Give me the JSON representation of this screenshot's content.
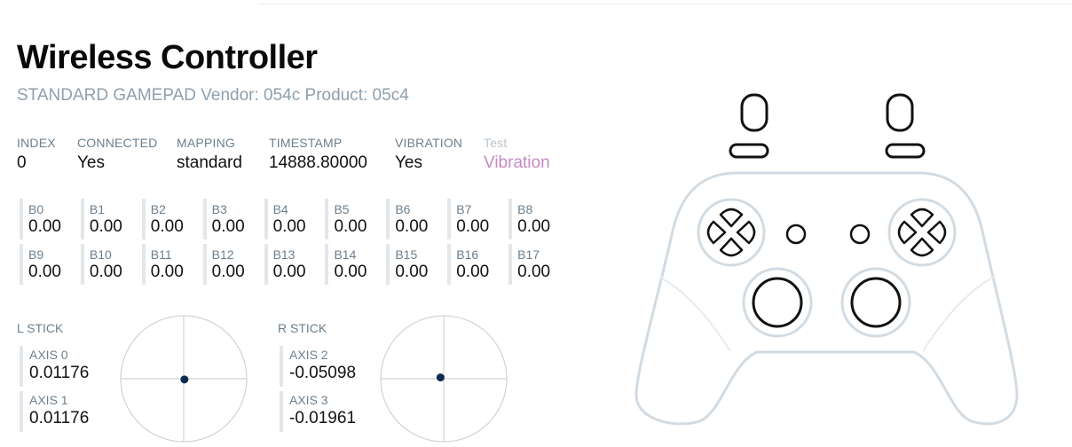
{
  "header": {
    "title": "Wireless Controller",
    "subtitle": "STANDARD GAMEPAD Vendor: 054c Product: 05c4"
  },
  "info": {
    "index": {
      "label": "INDEX",
      "value": "0"
    },
    "connected": {
      "label": "CONNECTED",
      "value": "Yes"
    },
    "mapping": {
      "label": "MAPPING",
      "value": "standard"
    },
    "timestamp": {
      "label": "TIMESTAMP",
      "value": "14888.80000"
    },
    "vibration": {
      "label": "VIBRATION",
      "value": "Yes"
    },
    "test": {
      "label": "Test",
      "value": "Vibration"
    }
  },
  "buttons": [
    {
      "label": "B0",
      "value": "0.00"
    },
    {
      "label": "B1",
      "value": "0.00"
    },
    {
      "label": "B2",
      "value": "0.00"
    },
    {
      "label": "B3",
      "value": "0.00"
    },
    {
      "label": "B4",
      "value": "0.00"
    },
    {
      "label": "B5",
      "value": "0.00"
    },
    {
      "label": "B6",
      "value": "0.00"
    },
    {
      "label": "B7",
      "value": "0.00"
    },
    {
      "label": "B8",
      "value": "0.00"
    },
    {
      "label": "B9",
      "value": "0.00"
    },
    {
      "label": "B10",
      "value": "0.00"
    },
    {
      "label": "B11",
      "value": "0.00"
    },
    {
      "label": "B12",
      "value": "0.00"
    },
    {
      "label": "B13",
      "value": "0.00"
    },
    {
      "label": "B14",
      "value": "0.00"
    },
    {
      "label": "B15",
      "value": "0.00"
    },
    {
      "label": "B16",
      "value": "0.00"
    },
    {
      "label": "B17",
      "value": "0.00"
    }
  ],
  "sticks": {
    "left": {
      "title": "L STICK",
      "axes": [
        {
          "label": "AXIS 0",
          "value": "0.01176"
        },
        {
          "label": "AXIS 1",
          "value": "0.01176"
        }
      ]
    },
    "right": {
      "title": "R STICK",
      "axes": [
        {
          "label": "AXIS 2",
          "value": "-0.05098"
        },
        {
          "label": "AXIS 3",
          "value": "-0.01961"
        }
      ]
    }
  },
  "colors": {
    "stick_dot": "#0d2c4f",
    "outline_light": "#d2dbe2",
    "outline_dark": "#111111",
    "accent_link": "#c58ac4"
  }
}
